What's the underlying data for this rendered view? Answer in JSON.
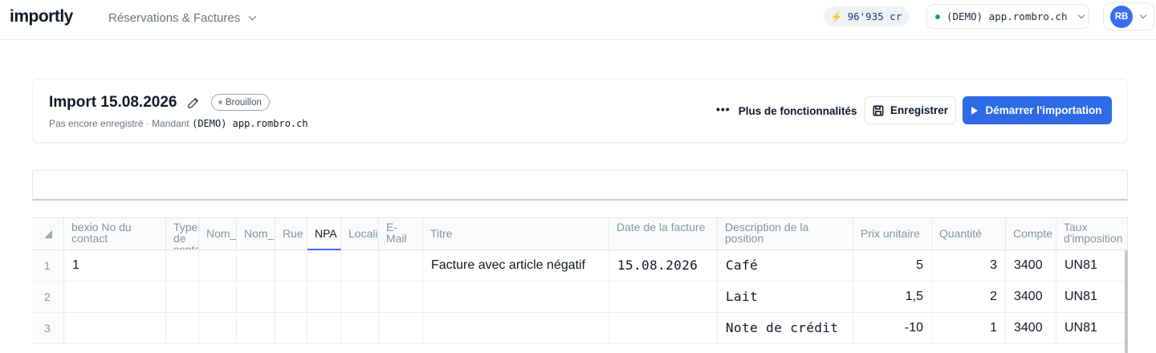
{
  "topbar": {
    "logo": "importly",
    "nav_label": "Réservations & Factures",
    "credits": "96'935 cr",
    "tenant": "(DEMO) app.rombro.ch",
    "user_initials": "RB"
  },
  "header": {
    "title": "Import 15.08.2026",
    "status_badge": "Brouillon",
    "subtitle_prefix": "Pas encore enregistré · Mandant ",
    "subtitle_tenant": "(DEMO) app.rombro.ch",
    "more_label": "Plus de fonctionnalités",
    "save_label": "Enregistrer",
    "start_label": "Démarrer l'importation"
  },
  "formula_bar": {
    "value": ""
  },
  "grid": {
    "columns": [
      "bexio No du contact",
      "Type de contact",
      "Nom_",
      "Nom_",
      "Rue",
      "NPA",
      "Locali",
      "E-Mail",
      "Titre",
      "Date de la facture",
      "Description de la position",
      "Prix unitaire",
      "Quantité",
      "Compte",
      "Taux d'imposition"
    ],
    "rows": [
      {
        "num": "1",
        "cells": [
          "1",
          "",
          "",
          "",
          "",
          "",
          "",
          "",
          "Facture avec article négatif",
          "15.08.2026",
          "Café",
          "5",
          "3",
          "3400",
          "UN81"
        ]
      },
      {
        "num": "2",
        "cells": [
          "",
          "",
          "",
          "",
          "",
          "",
          "",
          "",
          "",
          "",
          "Lait",
          "1,5",
          "2",
          "3400",
          "UN81"
        ]
      },
      {
        "num": "3",
        "cells": [
          "",
          "",
          "",
          "",
          "",
          "",
          "",
          "",
          "",
          "",
          "Note de crédit",
          "-10",
          "1",
          "3400",
          "UN81"
        ]
      }
    ]
  },
  "colors": {
    "accent": "#2e6ae6",
    "status_dot": "#22a06b",
    "avatar": "#3b6cf0"
  },
  "icons": [
    "bolt-icon",
    "chevron-down-icon",
    "pencil-icon",
    "more-horizontal-icon",
    "save-icon",
    "play-icon",
    "select-all-icon"
  ]
}
